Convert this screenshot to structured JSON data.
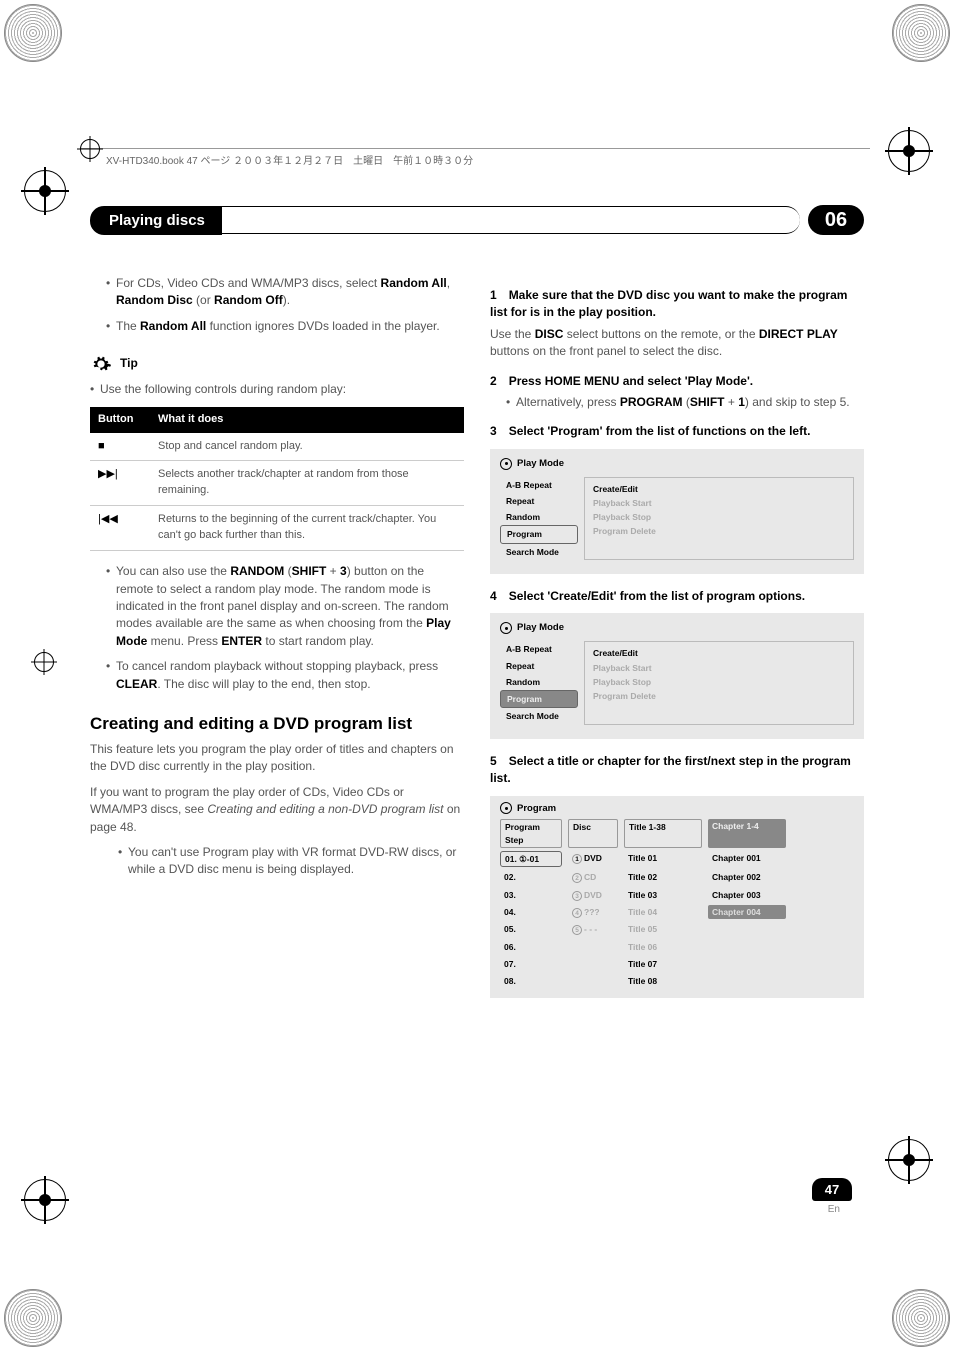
{
  "crop_header": "XV-HTD340.book 47 ページ ２００３年１２月２７日　土曜日　午前１０時３０分",
  "section": {
    "title": "Playing discs",
    "number": "06"
  },
  "left": {
    "bullets_top": [
      {
        "pre": "For CDs, Video CDs and WMA/MP3 discs, select ",
        "b1": "Random All",
        "mid": ", ",
        "b2": "Random Disc",
        "post": " (or ",
        "b3": "Random Off",
        "end": ")."
      },
      {
        "pre": "The ",
        "b1": "Random All",
        "post": " function ignores DVDs loaded in the player."
      }
    ],
    "tip_label": "Tip",
    "tip_text": "Use the following controls during random play:",
    "table": {
      "h1": "Button",
      "h2": "What it does",
      "rows": [
        {
          "btn": "■",
          "desc": "Stop and cancel random play."
        },
        {
          "btn": "▶▶|",
          "desc": "Selects another track/chapter at random from those remaining."
        },
        {
          "btn": "|◀◀",
          "desc": "Returns to the beginning of the current track/chapter. You can't go back further than this."
        }
      ]
    },
    "after_table_1a": "You can also use the ",
    "after_table_1b": "RANDOM",
    "after_table_1c": " (",
    "after_table_1d": "SHIFT",
    "after_table_1e": " + ",
    "after_table_1f": "3",
    "after_table_1g": ") button on the remote to select a random play mode. The random mode is indicated in the front panel display and on-screen. The random modes available are the same as when choosing from the ",
    "after_table_1h": "Play Mode",
    "after_table_1i": " menu. Press ",
    "after_table_1j": "ENTER",
    "after_table_1k": " to start random play.",
    "after_table_2a": "To cancel random playback without stopping playback, press ",
    "after_table_2b": "CLEAR",
    "after_table_2c": ". The disc will play to the end, then stop.",
    "h2": "Creating and editing a DVD program list",
    "p1": "This feature lets you program the play order of titles and chapters on the DVD disc currently in the play position.",
    "p2a": "If you want to program the play order of CDs, Video CDs or WMA/MP3 discs, see ",
    "p2b": "Creating and editing a non-DVD program list",
    "p2c": " on page 48.",
    "p3": "You can't use Program play with VR format DVD-RW discs, or while a DVD disc menu is being displayed."
  },
  "right": {
    "s1_head": "Make sure that the DVD disc you want to make the program list for is in the play position.",
    "s1_body_a": "Use the ",
    "s1_body_b": "DISC",
    "s1_body_c": " select buttons on the remote, or the ",
    "s1_body_d": "DIRECT PLAY",
    "s1_body_e": " buttons on the front panel to select the disc.",
    "s2_head": "Press HOME MENU and select 'Play Mode'.",
    "s2_b_a": "Alternatively, press ",
    "s2_b_b": "PROGRAM",
    "s2_b_c": " (",
    "s2_b_d": "SHIFT",
    "s2_b_e": " + ",
    "s2_b_f": "1",
    "s2_b_g": ") and skip to step 5.",
    "s3_head": "Select 'Program' from the list of functions on the left.",
    "s4_head": "Select 'Create/Edit' from the list of program options.",
    "s5_head": "Select a title or chapter for the first/next step in the program list.",
    "menu": {
      "title": "Play Mode",
      "left_items": [
        "A-B Repeat",
        "Repeat",
        "Random",
        "Program",
        "Search Mode"
      ],
      "right_items": [
        "Create/Edit",
        "Playback Start",
        "Playback Stop",
        "Program Delete"
      ]
    },
    "program": {
      "title": "Program",
      "headers": [
        "Program Step",
        "Disc",
        "Title 1-38",
        "Chapter 1-4"
      ],
      "steps": [
        "01. ①-01",
        "02.",
        "03.",
        "04.",
        "05.",
        "06.",
        "07.",
        "08."
      ],
      "discs": [
        {
          "n": "1",
          "t": "DVD",
          "dark": true
        },
        {
          "n": "2",
          "t": "CD"
        },
        {
          "n": "3",
          "t": "DVD"
        },
        {
          "n": "4",
          "t": "???"
        },
        {
          "n": "5",
          "t": "- - -"
        }
      ],
      "titles": [
        "Title 01",
        "Title 02",
        "Title 03",
        "Title 04",
        "Title 05",
        "Title 06",
        "Title 07",
        "Title 08"
      ],
      "chapters": [
        "Chapter 001",
        "Chapter 002",
        "Chapter 003",
        "Chapter 004"
      ]
    }
  },
  "page": {
    "num": "47",
    "lang": "En"
  }
}
